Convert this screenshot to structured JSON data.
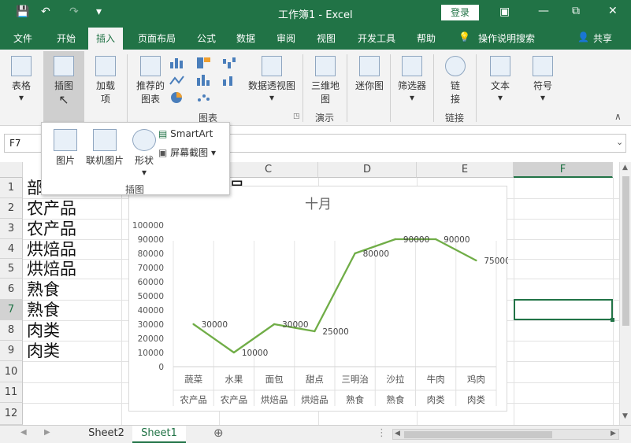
{
  "window": {
    "title": "工作簿1  -  Excel",
    "login_label": "登录",
    "minimize": "—",
    "restore": "⧉",
    "close": "✕",
    "save_icon": "💾",
    "undo_icon": "↶",
    "redo_icon": "↷",
    "customize_icon": "▾"
  },
  "tabs": [
    "文件",
    "开始",
    "插入",
    "页面布局",
    "公式",
    "数据",
    "审阅",
    "视图",
    "开发工具",
    "帮助"
  ],
  "active_tab": "插入",
  "tell_me": "操作说明搜索",
  "share_label": "共享",
  "ribbon": {
    "table": "表格",
    "illustrations": "插图",
    "addins": "加载\n项",
    "recommended_charts": "推荐的\n图表",
    "pivot_chart": "数据透视图",
    "map_3d": "三维地\n图",
    "sparklines": "迷你图",
    "slicer": "筛选器",
    "link": "链\n接",
    "text": "文本",
    "symbol": "符号",
    "group_charts": "图表",
    "group_tour": "演示",
    "group_links": "链接"
  },
  "popup": {
    "picture": "图片",
    "online_picture": "联机图片",
    "shapes": "形状",
    "smartart": "SmartArt",
    "screenshot": "屏幕截图",
    "group_label": "插图"
  },
  "name_box": "F7",
  "columns": [
    "C",
    "D",
    "E",
    "F"
  ],
  "rows": [
    "1",
    "2",
    "3",
    "4",
    "5",
    "6",
    "7",
    "8",
    "9",
    "10",
    "11",
    "12"
  ],
  "cells": {
    "a1": "部",
    "a2": "农产品",
    "a3": "农产品",
    "a4": "烘焙品",
    "a5": "烘焙品",
    "a6": "熟食",
    "a7": "熟食",
    "a8": "肉类",
    "a9": "肉类",
    "c1": "月"
  },
  "chart_data": {
    "type": "line",
    "title": "十月",
    "categories": [
      [
        "蔬菜",
        "农产品"
      ],
      [
        "水果",
        "农产品"
      ],
      [
        "面包",
        "烘焙品"
      ],
      [
        "甜点",
        "烘焙品"
      ],
      [
        "三明治",
        "熟食"
      ],
      [
        "沙拉",
        "熟食"
      ],
      [
        "牛肉",
        "肉类"
      ],
      [
        "鸡肉",
        "肉类"
      ]
    ],
    "values": [
      30000,
      10000,
      30000,
      25000,
      80000,
      90000,
      90000,
      75000
    ],
    "ylim": [
      0,
      100000
    ],
    "yticks": [
      "0",
      "10000",
      "20000",
      "30000",
      "40000",
      "50000",
      "60000",
      "70000",
      "80000",
      "90000",
      "100000"
    ],
    "data_labels": [
      "30000",
      "10000",
      "30000",
      "25000",
      "80000",
      "90000",
      "90000",
      "75000"
    ],
    "color": "#70ad47",
    "grid": "vertical"
  },
  "sheets": [
    "Sheet2",
    "Sheet1"
  ],
  "active_sheet": "Sheet1"
}
